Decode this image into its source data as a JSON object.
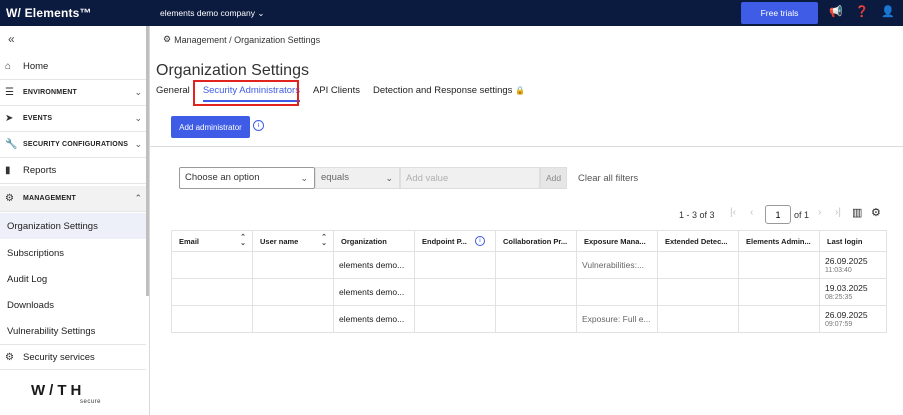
{
  "topbar": {
    "logo": "W/ Elements™",
    "company": "elements demo company",
    "free_trials": "Free trials"
  },
  "sidebar": {
    "items": [
      {
        "label": "Home"
      },
      {
        "label": "ENVIRONMENT"
      },
      {
        "label": "EVENTS"
      },
      {
        "label": "SECURITY CONFIGURATIONS"
      },
      {
        "label": "Reports"
      },
      {
        "label": "MANAGEMENT"
      }
    ],
    "management_items": [
      {
        "label": "Organization Settings"
      },
      {
        "label": "Subscriptions"
      },
      {
        "label": "Audit Log"
      },
      {
        "label": "Downloads"
      },
      {
        "label": "Vulnerability Settings"
      }
    ],
    "security_services": "Security services",
    "brand": "W/TH",
    "brand_sub": "secure"
  },
  "breadcrumb": "Management / Organization Settings",
  "page_title": "Organization Settings",
  "tabs": [
    {
      "label": "General"
    },
    {
      "label": "Security Administrators"
    },
    {
      "label": "API Clients"
    },
    {
      "label": "Detection and Response settings"
    }
  ],
  "add_admin_label": "Add administrator",
  "filter": {
    "field_placeholder": "Choose an option",
    "operator": "equals",
    "value_placeholder": "Add value",
    "add_label": "Add",
    "clear_label": "Clear all filters"
  },
  "pager": {
    "range": "1 - 3 of 3",
    "page": "1",
    "of": "of 1"
  },
  "table": {
    "headers": [
      "Email",
      "User name",
      "Organization",
      "Endpoint P...",
      "Collaboration Pr...",
      "Exposure Mana...",
      "Extended Detec...",
      "Elements Admin...",
      "Last login"
    ],
    "rows": [
      {
        "organization": "elements demo...",
        "exposure": "Vulnerabilities:...",
        "date": "26.09.2025",
        "time": "11:03:40"
      },
      {
        "organization": "elements demo...",
        "exposure": "",
        "date": "19.03.2025",
        "time": "08:25:35"
      },
      {
        "organization": "elements demo...",
        "exposure": "Exposure: Full e...",
        "date": "26.09.2025",
        "time": "09:07:59"
      }
    ]
  }
}
